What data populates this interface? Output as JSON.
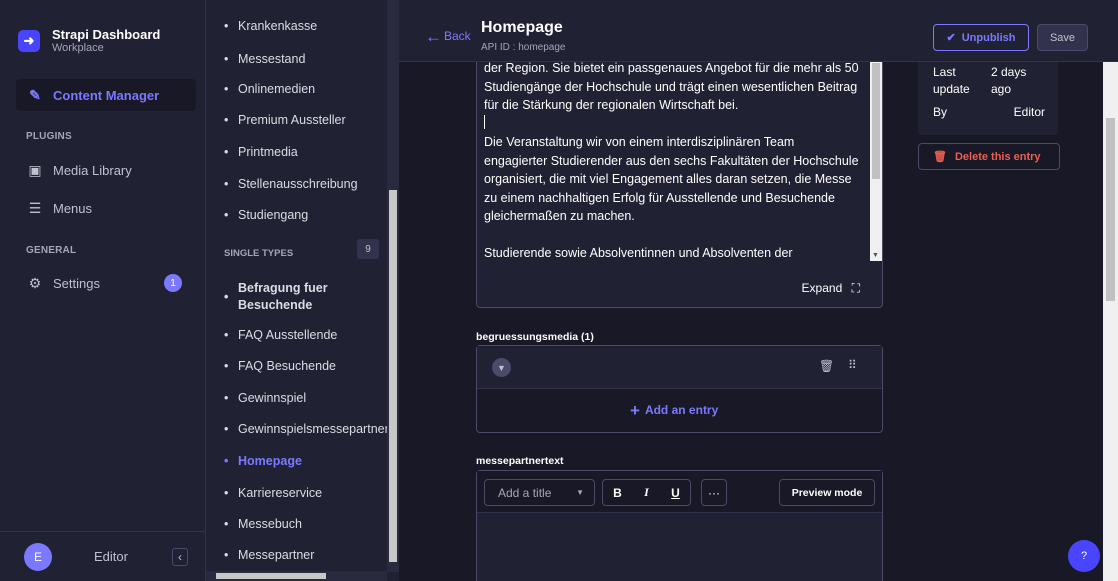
{
  "brand": {
    "title": "Strapi Dashboard",
    "subtitle": "Workplace",
    "logo": "strapi-logo"
  },
  "mainnav": {
    "content_manager": "Content Manager",
    "plugins_heading": "PLUGINS",
    "media_library": "Media Library",
    "menus": "Menus",
    "general_heading": "GENERAL",
    "settings": "Settings",
    "settings_badge": "1",
    "user_initial": "E",
    "user_name": "Editor",
    "collapse_glyph": "‹"
  },
  "collection_list": {
    "items_top": [
      "Krankenkasse",
      "Messestand",
      "Onlinemedien",
      "Premium Aussteller",
      "Printmedia",
      "Stellenausschreibung",
      "Studiengang"
    ],
    "single_types_heading": "SINGLE TYPES",
    "single_types_count": "9",
    "single_types": [
      "Befragung fuer Besuchende",
      "FAQ Ausstellende",
      "FAQ Besuchende",
      "Gewinnspiel",
      "Gewinnspielsmessepartner",
      "Homepage",
      "Karriereservice",
      "Messebuch",
      "Messepartner"
    ],
    "active_item": "Homepage"
  },
  "header": {
    "back_label": "Back",
    "title": "Homepage",
    "api_id": "API ID : homepage",
    "unpublish_label": "Unpublish",
    "save_label": "Save"
  },
  "richtext": {
    "paragraph_1": "der Region. Sie bietet ein passgenaues Angebot für die mehr als 50 Studiengänge der Hochschule und trägt einen wesentlichen Beitrag für die Stärkung der regionalen Wirtschaft bei.",
    "paragraph_2": "Die Veranstaltung wir von einem interdisziplinären Team engagierter Studierender aus den sechs Fakultäten der Hochschule organisiert, die mit viel Engagement alles daran setzen, die Messe zu einem nachhaltigen Erfolg für Ausstellende und Besuchende gleichermaßen zu machen.",
    "paragraph_3": "Studierende sowie Absolventinnen und Absolventen der",
    "expand_label": "Expand"
  },
  "media_field": {
    "label": "begruessungsmedia (1)",
    "add_entry": "Add an entry"
  },
  "text_field": {
    "label": "messepartnertext",
    "title_placeholder": "Add a title",
    "bold": "B",
    "italic": "I",
    "underline": "U",
    "more": "···",
    "preview_label": "Preview mode"
  },
  "sidebar_info": {
    "last_update_label": "Last update",
    "last_update_value": "2 days ago",
    "by_label": "By",
    "by_value": "Editor",
    "delete_label": "Delete this entry"
  },
  "help_label": "?",
  "colors": {
    "accent": "#7b79ff",
    "primary": "#4945ff",
    "danger": "#ee5e52",
    "background": "#181826",
    "panel": "#212134"
  }
}
